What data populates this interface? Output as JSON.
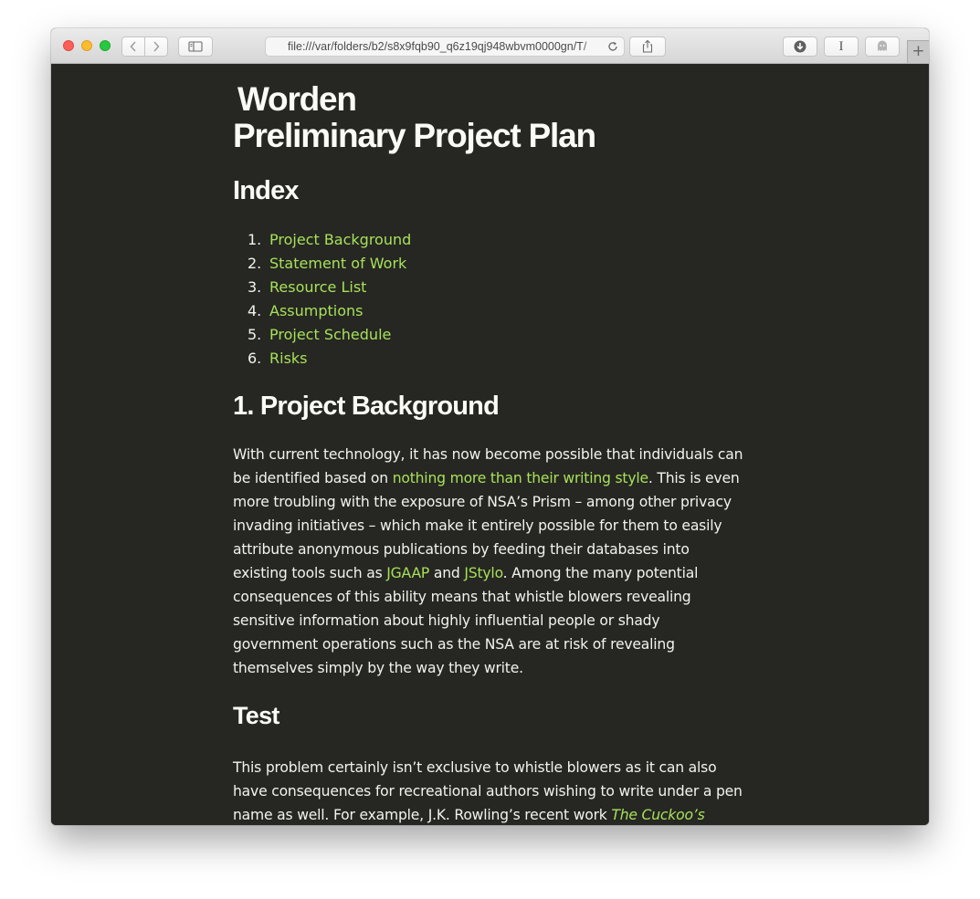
{
  "browser": {
    "url": "file:///var/folders/b2/s8x9fqb90_q6z19qj948wbvm0000gn/T/",
    "new_tab_label": "+",
    "reader_label": "I"
  },
  "doc": {
    "title_line1": "Worden",
    "title_line2": "Preliminary Project Plan",
    "index_heading": "Index",
    "toc": [
      {
        "num": "1.",
        "label": "Project Background"
      },
      {
        "num": "2.",
        "label": "Statement of Work"
      },
      {
        "num": "3.",
        "label": "Resource List"
      },
      {
        "num": "4.",
        "label": "Assumptions"
      },
      {
        "num": "5.",
        "label": "Project Schedule"
      },
      {
        "num": "6.",
        "label": "Risks"
      }
    ],
    "section1_heading": "1. Project Background",
    "p1": {
      "t1": "With current technology, it has now become possible that individuals can be identified based on ",
      "link1": "nothing more than their writing style",
      "t2": ". This is even more troubling with the exposure of NSA’s Prism – among other privacy invading initiatives – which make it entirely possible for them to easily attribute anonymous publications by feeding their databases into existing tools such as ",
      "link2": "JGAAP",
      "t3": " and ",
      "link3": "JStylo",
      "t4": ". Among the many potential consequences of this ability means that whistle blowers revealing sensitive information about highly influential people or shady government operations such as the NSA are at risk of revealing themselves simply by the way they write."
    },
    "test_heading": "Test",
    "p2": {
      "t1": "This problem certainly isn’t exclusive to whistle blowers as it can also have consequences for recreational authors wishing to write under a pen name as well. For example, J.K. Rowling’s recent work ",
      "link1": "The Cuckoo’s"
    }
  },
  "colors": {
    "page_background": "#262622",
    "text": "#f2f2ef",
    "link": "#a6e15a"
  }
}
